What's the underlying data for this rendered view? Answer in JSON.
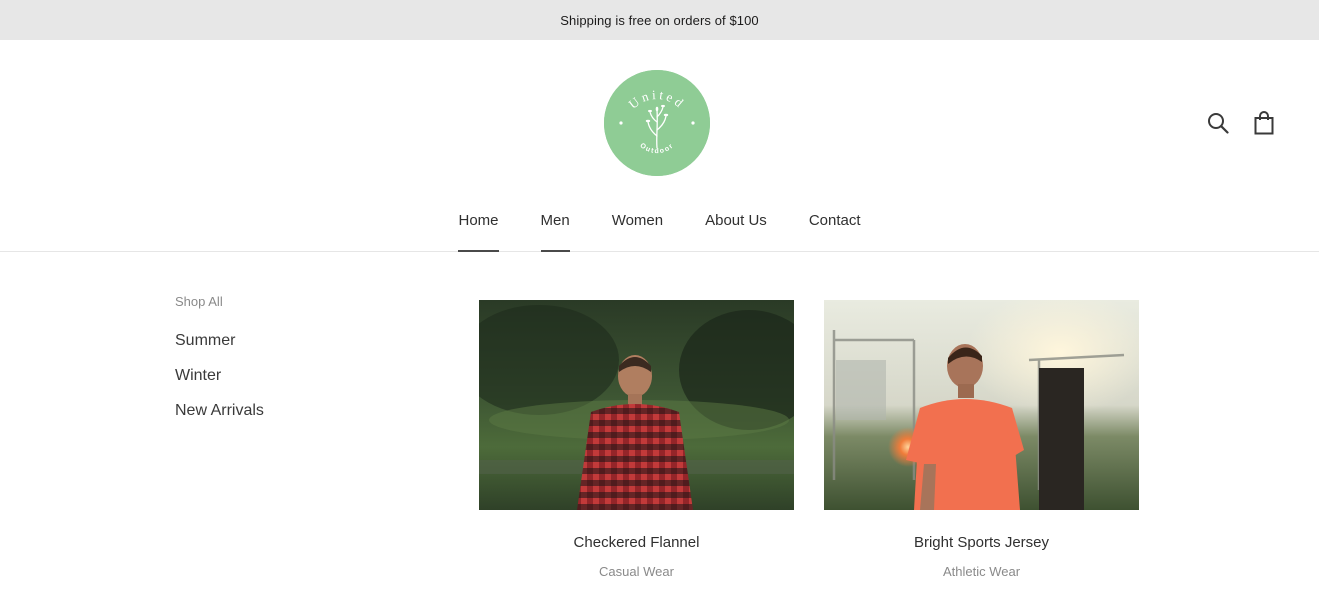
{
  "announcement": {
    "text": "Shipping is free on orders of $100"
  },
  "brand": {
    "logo_top_text": "United",
    "logo_bottom_text": "Outdoor",
    "logo_color": "#8fcc95"
  },
  "header_icons": {
    "search_icon": "search-icon",
    "cart_icon": "shopping-bag-icon"
  },
  "nav": {
    "items": [
      {
        "label": "Home",
        "active": true
      },
      {
        "label": "Men",
        "active": true
      },
      {
        "label": "Women",
        "active": false
      },
      {
        "label": "About Us",
        "active": false
      },
      {
        "label": "Contact",
        "active": false
      }
    ]
  },
  "sidebar": {
    "heading": "Shop All",
    "links": [
      "Summer",
      "Winter",
      "New Arrivals"
    ]
  },
  "products": [
    {
      "title": "Checkered Flannel",
      "subtitle": "Casual Wear"
    },
    {
      "title": "Bright Sports Jersey",
      "subtitle": "Athletic Wear"
    }
  ]
}
